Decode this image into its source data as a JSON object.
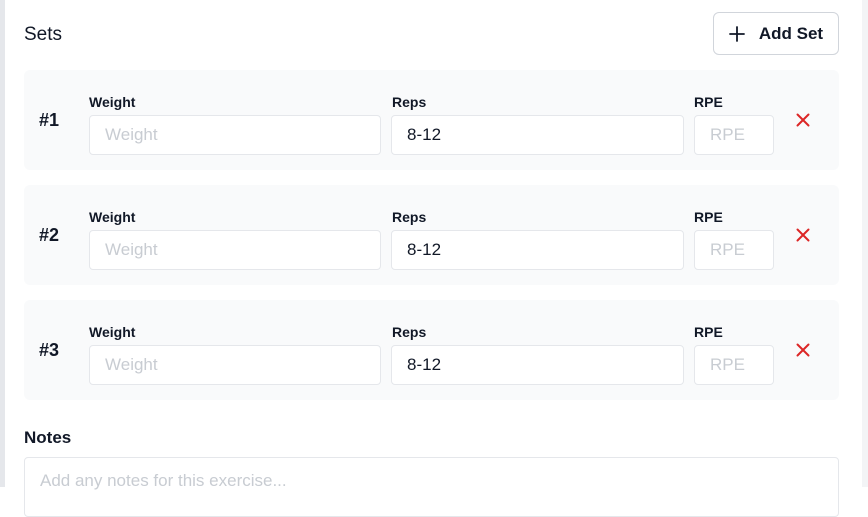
{
  "header": {
    "title": "Sets",
    "add_button_label": "Add Set"
  },
  "labels": {
    "weight": "Weight",
    "reps": "Reps",
    "rpe": "RPE"
  },
  "sets": [
    {
      "number": "#1",
      "weight_value": "",
      "weight_placeholder": "Weight",
      "reps_value": "8-12",
      "rpe_value": "",
      "rpe_placeholder": "RPE"
    },
    {
      "number": "#2",
      "weight_value": "",
      "weight_placeholder": "Weight",
      "reps_value": "8-12",
      "rpe_value": "",
      "rpe_placeholder": "RPE"
    },
    {
      "number": "#3",
      "weight_value": "",
      "weight_placeholder": "Weight",
      "reps_value": "8-12",
      "rpe_value": "",
      "rpe_placeholder": "RPE"
    }
  ],
  "notes": {
    "label": "Notes",
    "placeholder": "Add any notes for this exercise...",
    "value": ""
  },
  "colors": {
    "remove_icon": "#dc2626",
    "row_background": "#f9fafb",
    "input_border": "#e5e7eb"
  },
  "icons": {
    "add": "plus-icon",
    "remove": "close-icon"
  }
}
